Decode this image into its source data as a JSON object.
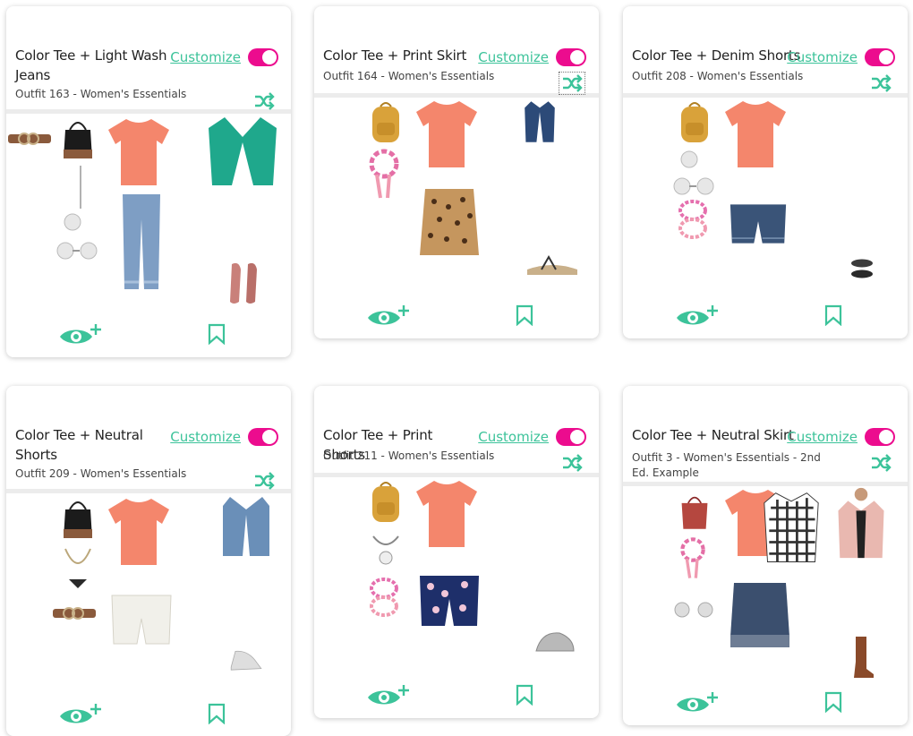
{
  "accent": "#3cc39a",
  "toggle_color": "#ec0c8e",
  "cards": [
    {
      "title": "Color Tee + Light Wash Jeans",
      "subtitle": "Outfit 163 - Women's Essentials",
      "customize": "Customize",
      "toggle_on": true
    },
    {
      "title": "Color Tee + Print Skirt",
      "subtitle": "Outfit 164 - Women's Essentials",
      "customize": "Customize",
      "toggle_on": true
    },
    {
      "title": "Color Tee + Denim Shorts",
      "subtitle": "Outfit 208 - Women's Essentials",
      "customize": "Customize",
      "toggle_on": true
    },
    {
      "title": "Color Tee + Neutral Shorts",
      "subtitle": "Outfit 209 - Women's Essentials",
      "customize": "Customize",
      "toggle_on": true
    },
    {
      "title": "Color Tee + Print Shorts",
      "subtitle": "Outfit 211 - Women's Essentials",
      "customize": "Customize",
      "toggle_on": true
    },
    {
      "title": "Color Tee + Neutral Skirt",
      "subtitle": "Outfit 3 - Women's Essentials - 2nd Ed. Example",
      "customize": "Customize",
      "toggle_on": true
    }
  ],
  "icons": {
    "eye_plus": "eye-plus-icon",
    "bookmark": "bookmark-icon",
    "shuffle": "shuffle-icon"
  }
}
